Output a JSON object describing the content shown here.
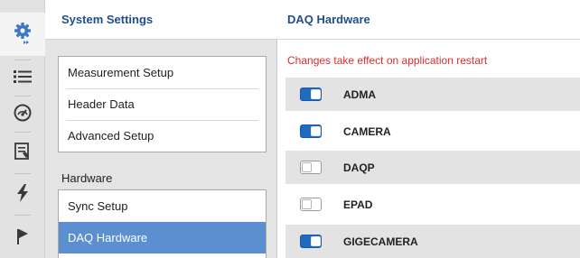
{
  "rail": {
    "icons": [
      "gear-icon",
      "list-icon",
      "gauge-icon",
      "document-icon",
      "lightning-icon",
      "flag-icon"
    ]
  },
  "system_settings": {
    "title": "System Settings",
    "menu": [
      {
        "label": "Measurement Setup"
      },
      {
        "label": "Header Data"
      },
      {
        "label": "Advanced Setup"
      }
    ],
    "hardware_label": "Hardware",
    "hardware_menu": [
      {
        "label": "Sync Setup",
        "active": false
      },
      {
        "label": "DAQ Hardware",
        "active": true
      }
    ]
  },
  "daq": {
    "title": "DAQ Hardware",
    "notice": "Changes take effect on application restart",
    "devices": [
      {
        "name": "ADMA",
        "enabled": true
      },
      {
        "name": "CAMERA",
        "enabled": true
      },
      {
        "name": "DAQP",
        "enabled": false
      },
      {
        "name": "EPAD",
        "enabled": false
      },
      {
        "name": "GIGECAMERA",
        "enabled": true
      }
    ]
  },
  "colors": {
    "accent": "#1f4e8c",
    "selected": "#5b8fcf",
    "toggle_on": "#1f6bc0",
    "notice": "#e02b2b"
  }
}
